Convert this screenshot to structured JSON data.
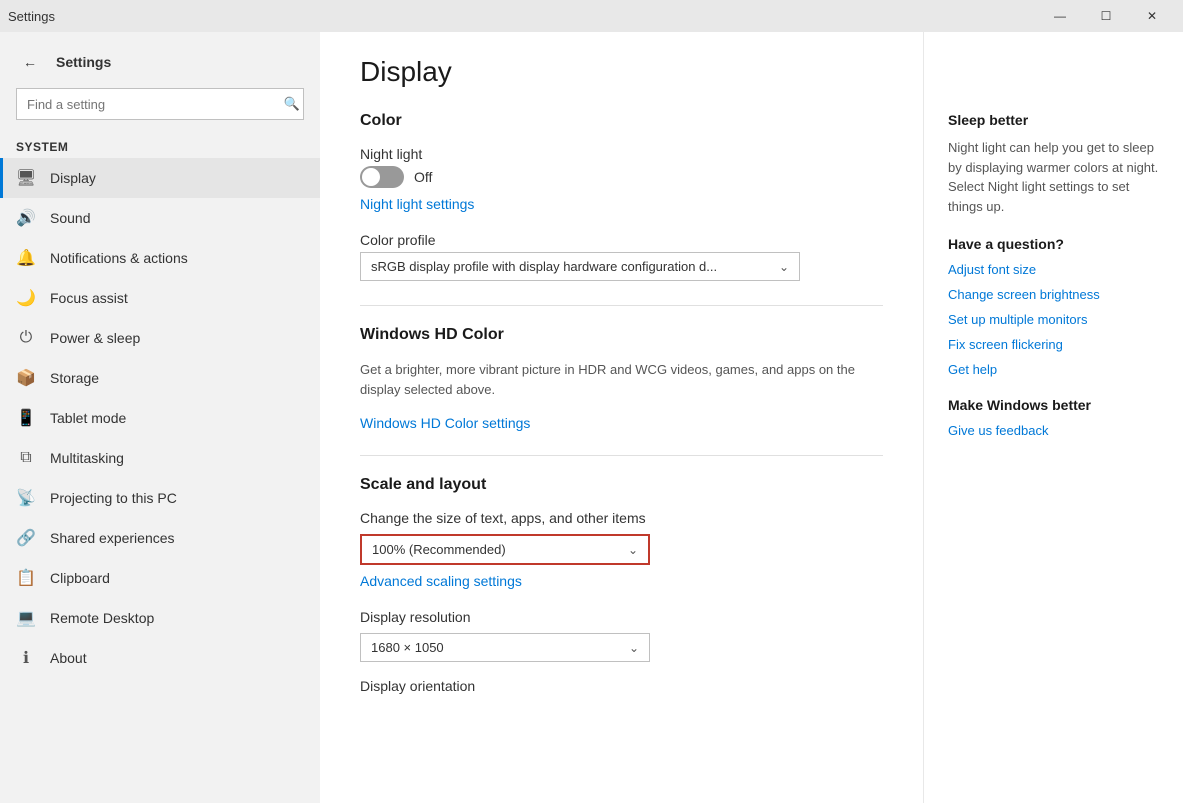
{
  "titleBar": {
    "title": "Settings",
    "minimize": "—",
    "maximize": "☐",
    "close": "✕"
  },
  "sidebar": {
    "appTitle": "Settings",
    "search": {
      "placeholder": "Find a setting",
      "value": ""
    },
    "sectionLabel": "System",
    "navItems": [
      {
        "id": "display",
        "label": "Display",
        "icon": "🖥",
        "active": true
      },
      {
        "id": "sound",
        "label": "Sound",
        "icon": "🔊",
        "active": false
      },
      {
        "id": "notifications",
        "label": "Notifications & actions",
        "icon": "🔔",
        "active": false
      },
      {
        "id": "focus",
        "label": "Focus assist",
        "icon": "🌙",
        "active": false
      },
      {
        "id": "power",
        "label": "Power & sleep",
        "icon": "⏻",
        "active": false
      },
      {
        "id": "storage",
        "label": "Storage",
        "icon": "📦",
        "active": false
      },
      {
        "id": "tablet",
        "label": "Tablet mode",
        "icon": "📱",
        "active": false
      },
      {
        "id": "multitasking",
        "label": "Multitasking",
        "icon": "⧉",
        "active": false
      },
      {
        "id": "projecting",
        "label": "Projecting to this PC",
        "icon": "📡",
        "active": false
      },
      {
        "id": "shared",
        "label": "Shared experiences",
        "icon": "🔗",
        "active": false
      },
      {
        "id": "clipboard",
        "label": "Clipboard",
        "icon": "📋",
        "active": false
      },
      {
        "id": "remote",
        "label": "Remote Desktop",
        "icon": "💻",
        "active": false
      },
      {
        "id": "about",
        "label": "About",
        "icon": "ℹ",
        "active": false
      }
    ]
  },
  "main": {
    "pageTitle": "Display",
    "colorSection": {
      "heading": "Color",
      "nightLight": {
        "label": "Night light",
        "status": "Off",
        "enabled": false
      },
      "nightLightSettings": "Night light settings",
      "colorProfile": {
        "label": "Color profile",
        "value": "sRGB display profile with display hardware configuration d...",
        "arrow": "⌄"
      }
    },
    "hdColorSection": {
      "heading": "Windows HD Color",
      "description": "Get a brighter, more vibrant picture in HDR and WCG videos, games, and apps on the display selected above.",
      "link": "Windows HD Color settings"
    },
    "scaleSection": {
      "heading": "Scale and layout",
      "sizeLabel": "Change the size of text, apps, and other items",
      "sizeValue": "100% (Recommended)",
      "sizeArrow": "⌄",
      "advancedLink": "Advanced scaling settings",
      "resolutionLabel": "Display resolution",
      "resolutionValue": "1680 × 1050",
      "resolutionArrow": "⌄",
      "orientationLabel": "Display orientation"
    }
  },
  "rightPanel": {
    "sleepBetter": {
      "heading": "Sleep better",
      "description": "Night light can help you get to sleep by displaying warmer colors at night. Select Night light settings to set things up."
    },
    "haveQuestion": {
      "heading": "Have a question?",
      "links": [
        "Adjust font size",
        "Change screen brightness",
        "Set up multiple monitors",
        "Fix screen flickering",
        "Get help"
      ]
    },
    "makeWindowsBetter": {
      "heading": "Make Windows better",
      "links": [
        "Give us feedback"
      ]
    }
  }
}
